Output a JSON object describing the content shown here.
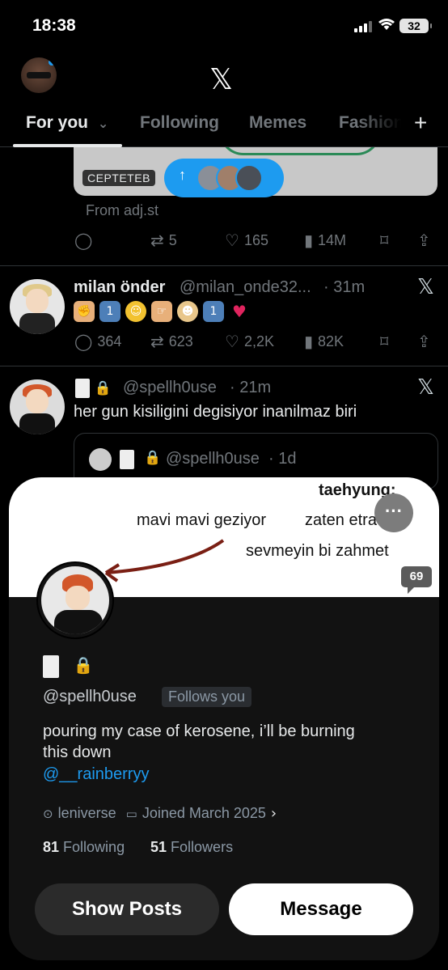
{
  "status": {
    "time": "18:38",
    "battery": "32"
  },
  "header": {
    "tabs": [
      {
        "label": "For you",
        "chevron": "⌄"
      },
      {
        "label": "Following"
      },
      {
        "label": "Memes"
      },
      {
        "label": "Fashion"
      }
    ],
    "logo": "𝕏",
    "plus": "+"
  },
  "feed": {
    "post1": {
      "badge": "CEPTETEB",
      "source": "From adj.st",
      "retweets": "5",
      "likes": "165",
      "views": "14M"
    },
    "post2": {
      "name": "milan önder",
      "handle": "@milan_onde32...",
      "time": "· 31m",
      "replies": "364",
      "retweets": "623",
      "likes": "2,2K",
      "views": "82K"
    },
    "post3": {
      "handle": "@spellh0use",
      "time": "· 21m",
      "text": "her gun kisiligini degisiyor inanilmaz biri",
      "quote_handle": "@spellh0use",
      "quote_time": "· 1d"
    }
  },
  "profile": {
    "banner": {
      "line1": "taehyung:",
      "line2a": "mavi mavi geziyor",
      "line2b": "zaten etra",
      "line3": "sevmeyin bi zahmet",
      "badge": "69"
    },
    "more": "···",
    "handle": "@spellh0use",
    "follows_you": "Follows you",
    "bio_line1": "pouring my case of kerosene, i’ll be burning",
    "bio_line2": "this down",
    "bio_mention": "@__rainberryy",
    "location": "leniverse",
    "joined": "Joined March 2025",
    "following_count": "81",
    "following_label": "Following",
    "followers_count": "51",
    "followers_label": "Followers",
    "show_posts": "Show Posts",
    "message": "Message"
  },
  "colors": {
    "accent": "#1d9bf0",
    "background": "#000000",
    "sheet": "#121212"
  }
}
